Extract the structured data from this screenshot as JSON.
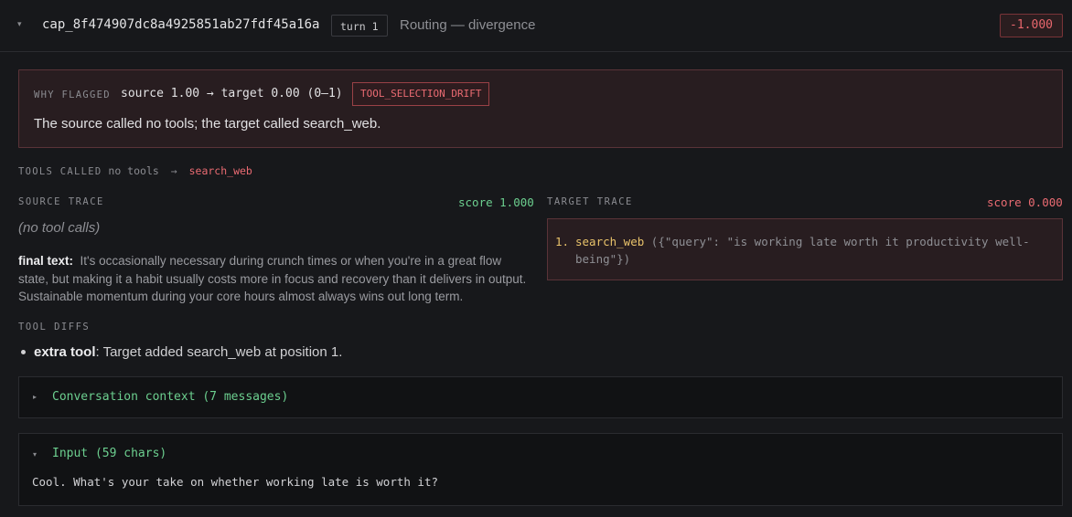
{
  "header": {
    "caret": "▾",
    "cap_id": "cap_8f474907dc8a4925851ab27fdf45a16a",
    "turn": "turn 1",
    "route": "Routing — divergence",
    "score": "-1.000"
  },
  "flag": {
    "label": "WHY FLAGGED",
    "summary": "source 1.00 → target 0.00 (0–1)",
    "tag": "TOOL_SELECTION_DRIFT",
    "text": "The source called no tools; the target called search_web."
  },
  "tools_called": {
    "label": "TOOLS CALLED",
    "source": "no tools",
    "arrow": "→",
    "target": "search_web"
  },
  "source_trace": {
    "label": "SOURCE TRACE",
    "score": "score 1.000",
    "no_calls": "(no tool calls)",
    "final_label": "final text:",
    "final_text": "It's occasionally necessary during crunch times or when you're in a great flow state, but making it a habit usually costs more in focus and recovery than it delivers in output. Sustainable momentum during your core hours almost always wins out long term."
  },
  "target_trace": {
    "label": "TARGET TRACE",
    "score": "score 0.000",
    "calls": [
      {
        "num": "1.",
        "name": "search_web",
        "args": "({\"query\": \"is working late worth it productivity well-being\"})"
      }
    ]
  },
  "tool_diffs": {
    "label": "TOOL DIFFS",
    "items": [
      {
        "kind": "extra tool",
        "text": ": Target added search_web at position 1."
      }
    ]
  },
  "conversation": {
    "caret": "▸",
    "title": "Conversation context (7 messages)"
  },
  "input": {
    "caret": "▾",
    "title": "Input (59 chars)",
    "text": "Cool. What's your take on whether working late is worth it?"
  },
  "colors": {
    "bg": "#17181b",
    "danger": "#ea6b72",
    "success": "#6ccf8f",
    "warning": "#e8c26a"
  }
}
